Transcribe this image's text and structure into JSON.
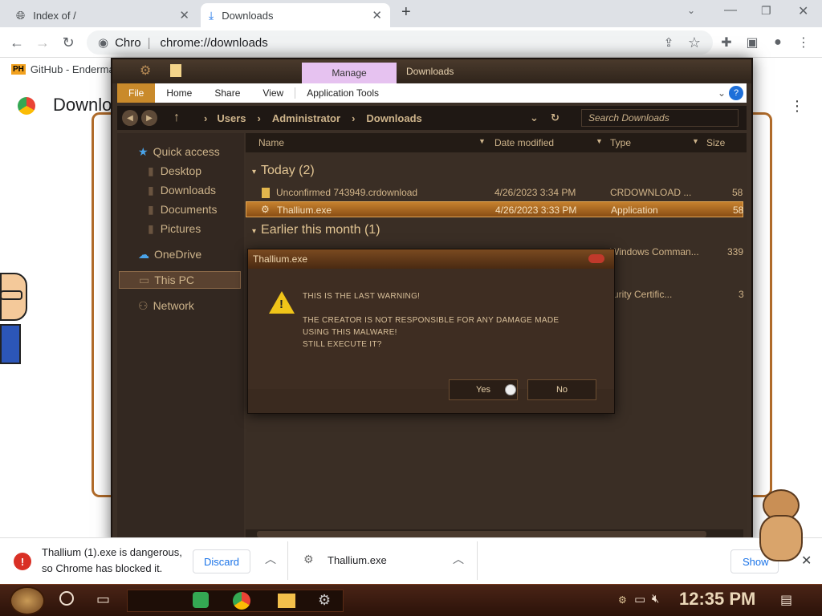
{
  "browser": {
    "tabs": [
      {
        "label": "Index of /",
        "active": false
      },
      {
        "label": "Downloads",
        "active": true
      }
    ],
    "new_tab": "+",
    "omnibox_prefix": "Chro",
    "omnibox_url": "chrome://downloads",
    "bookmark": "GitHub - Enderma",
    "bookmark_icon_text": "PH",
    "page_title": "Downloads"
  },
  "explorer": {
    "title": "Downloads",
    "manage": "Manage",
    "ribbon": [
      "File",
      "Home",
      "Share",
      "View",
      "Application Tools"
    ],
    "breadcrumb": [
      "Users",
      "Administrator",
      "Downloads"
    ],
    "search_placeholder": "Search Downloads",
    "nav": {
      "quick_access": "Quick access",
      "desktop": "Desktop",
      "downloads": "Downloads",
      "documents": "Documents",
      "pictures": "Pictures",
      "onedrive": "OneDrive",
      "this_pc": "This PC",
      "network": "Network"
    },
    "columns": [
      "Name",
      "Date modified",
      "Type",
      "Size"
    ],
    "group_today": "Today (2)",
    "group_earlier": "Earlier this month (1)",
    "files": [
      {
        "name": "Unconfirmed 743949.crdownload",
        "date": "4/26/2023 3:34 PM",
        "type": "CRDOWNLOAD ...",
        "size": "58"
      },
      {
        "name": "Thallium.exe",
        "date": "4/26/2023 3:33 PM",
        "type": "Application",
        "size": "58"
      }
    ],
    "earlier_files": [
      {
        "type": "Windows Comman...",
        "size": "339"
      },
      {
        "type": "urity Certific...",
        "size": "3"
      }
    ]
  },
  "dialog": {
    "title": "Thallium.exe",
    "line1": "THIS IS THE LAST WARNING!",
    "line2": "THE CREATOR IS NOT RESPONSIBLE FOR ANY DAMAGE MADE",
    "line3": "USING THIS MALWARE!",
    "line4": "STILL EXECUTE IT?",
    "yes": "Yes",
    "no": "No"
  },
  "download_bar": {
    "warning_line1": "Thallium (1).exe is dangerous,",
    "warning_line2": "so Chrome has blocked it.",
    "discard": "Discard",
    "item": "Thallium.exe",
    "show": "Show"
  },
  "taskbar": {
    "clock": "12:35 PM"
  }
}
